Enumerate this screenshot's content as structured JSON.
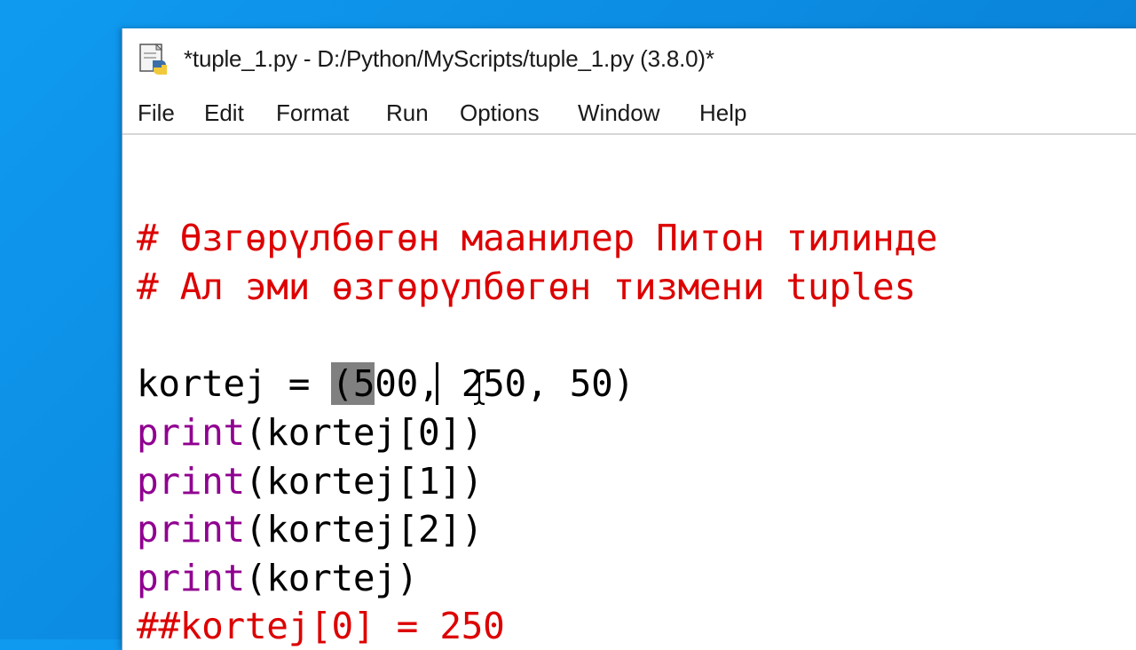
{
  "window": {
    "title": "*tuple_1.py - D:/Python/MyScripts/tuple_1.py (3.8.0)*",
    "icon": "python-idle-icon"
  },
  "menu": {
    "items": [
      "File",
      "Edit",
      "Format",
      "Run",
      "Options",
      "Window",
      "Help"
    ]
  },
  "editor": {
    "comment_1": "# Өзгөрүлбөгөн маанилер Питон тилинде",
    "comment_2": "# Ал эми өзгөрүлбөгөн тизмени tuples",
    "assign": {
      "name": "kortej = ",
      "open_paren_sel": "(5",
      "rest": "00, 250, 50)"
    },
    "print_lines": [
      {
        "func": "print",
        "args": "(kortej[0])"
      },
      {
        "func": "print",
        "args": "(kortej[1])"
      },
      {
        "func": "print",
        "args": "(kortej[2])"
      },
      {
        "func": "print",
        "args": "(kortej)"
      }
    ],
    "commented_code": "##kortej[0] = 250"
  },
  "colors": {
    "comment": "#dd0000",
    "builtin": "#900090",
    "desktop": "#0a86dc"
  }
}
